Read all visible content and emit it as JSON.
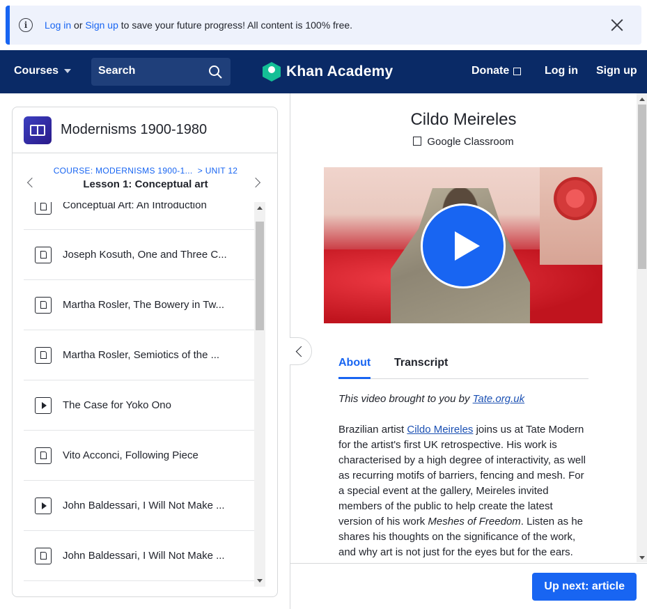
{
  "banner": {
    "login_link": "Log in",
    "or_text": "or",
    "signup_link": "Sign up",
    "message": "to save your future progress! All content is 100% free."
  },
  "nav": {
    "courses": "Courses",
    "search_placeholder": "Search",
    "brand": "Khan Academy",
    "donate": "Donate",
    "login": "Log in",
    "signup": "Sign up"
  },
  "sidebar": {
    "course_title": "Modernisms 1900-1980",
    "breadcrumb_course": "COURSE: MODERNISMS 1900-1...",
    "breadcrumb_sep": ">",
    "breadcrumb_unit": "UNIT 12",
    "lesson_title": "Lesson 1: Conceptual art",
    "items": [
      {
        "label": "Conceptual Art: An Introduction",
        "type": "article"
      },
      {
        "label": "Joseph Kosuth, One and Three C...",
        "type": "article"
      },
      {
        "label": "Martha Rosler, The Bowery in Tw...",
        "type": "article"
      },
      {
        "label": "Martha Rosler, Semiotics of the ...",
        "type": "article"
      },
      {
        "label": "The Case for Yoko Ono",
        "type": "video"
      },
      {
        "label": "Vito Acconci, Following Piece",
        "type": "article"
      },
      {
        "label": "John Baldessari, I Will Not Make ...",
        "type": "video"
      },
      {
        "label": "John Baldessari, I Will Not Make ...",
        "type": "article"
      }
    ]
  },
  "main": {
    "title": "Cildo Meireles",
    "classroom": "Google Classroom",
    "tabs": [
      {
        "label": "About",
        "active": true
      },
      {
        "label": "Transcript",
        "active": false
      }
    ],
    "credit_prefix": "This video brought to you by ",
    "credit_link": "Tate.org.uk",
    "desc_part1": "Brazilian artist ",
    "desc_link": "Cildo Meireles",
    "desc_part2": " joins us at Tate Modern for the artist's first UK retrospective. His work is characterised by a high degree of interactivity, as well as recurring motifs of barriers, fencing and mesh. For a special event at the gallery, Meireles invited members of the public to help create the latest version of his work ",
    "desc_italic1": "Meshes of Freedom",
    "desc_part3": ". Listen as he shares his thoughts on the significance of the work, and why art is not just for the eyes but for the ears.",
    "up_next": "Up next: article"
  },
  "colors": {
    "brand_blue": "#1865f2",
    "nav_bg": "#0a2a66",
    "logo_green": "#14bf96"
  }
}
